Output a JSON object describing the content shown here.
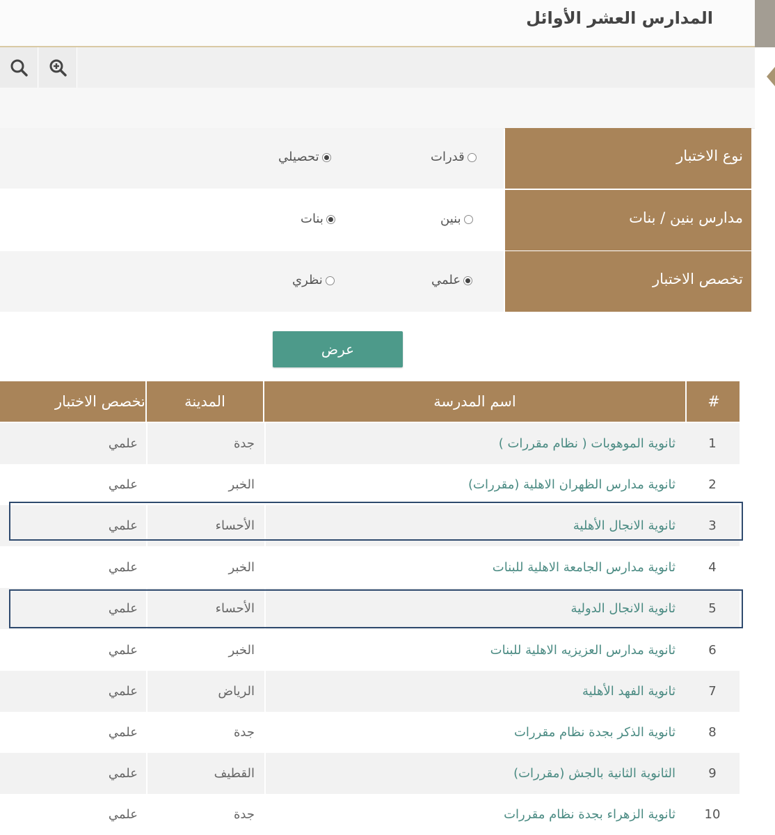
{
  "header": {
    "title": "المدارس العشر الأوائل"
  },
  "toolbar": {
    "tools": [
      "zoom-in-icon",
      "search-icon"
    ]
  },
  "filters": {
    "test_type": {
      "label": "نوع الاختبار",
      "options": [
        "قدرات",
        "تحصيلي"
      ],
      "selected": "تحصيلي"
    },
    "gender": {
      "label": "مدارس بنين / بنات",
      "options": [
        "بنين",
        "بنات"
      ],
      "selected": "بنات"
    },
    "specialization": {
      "label": "تخصص الاختبار",
      "options": [
        "علمي",
        "نظري"
      ],
      "selected": "علمي"
    },
    "show_button": "عرض"
  },
  "table": {
    "headers": {
      "num": "#",
      "name": "اسم المدرسة",
      "city": "المدينة",
      "spec": "تخصص الاختبار"
    },
    "rows": [
      {
        "num": "1",
        "name": "ثانوية الموهوبات ( نظام مقررات )",
        "city": "جدة",
        "spec": "علمي"
      },
      {
        "num": "2",
        "name": "ثانوية مدارس الظهران الاهلية (مقررات)",
        "city": "الخبر",
        "spec": "علمي"
      },
      {
        "num": "3",
        "name": "ثانوية الانجال الأهلية",
        "city": "الأحساء",
        "spec": "علمي"
      },
      {
        "num": "4",
        "name": "ثانوية مدارس الجامعة الاهلية للبنات",
        "city": "الخبر",
        "spec": "علمي"
      },
      {
        "num": "5",
        "name": "ثانوية الانجال الدولية",
        "city": "الأحساء",
        "spec": "علمي"
      },
      {
        "num": "6",
        "name": "ثانوية مدارس العزيزيه الاهلية للبنات",
        "city": "الخبر",
        "spec": "علمي"
      },
      {
        "num": "7",
        "name": "ثانوية الفهد الأهلية",
        "city": "الرياض",
        "spec": "علمي"
      },
      {
        "num": "8",
        "name": "ثانوية الذكر بجدة نظام مقررات",
        "city": "جدة",
        "spec": "علمي"
      },
      {
        "num": "9",
        "name": "الثانوية الثانية بالجش (مقررات)",
        "city": "القطيف",
        "spec": "علمي"
      },
      {
        "num": "10",
        "name": "ثانوية الزهراء بجدة نظام مقررات",
        "city": "جدة",
        "spec": "علمي"
      }
    ],
    "highlighted_rows": [
      "3",
      "5"
    ]
  },
  "colors": {
    "accent": "#a98459",
    "button": "#4d9a8a",
    "link": "#4b8b83",
    "highlight_border": "#2f4a6e"
  }
}
